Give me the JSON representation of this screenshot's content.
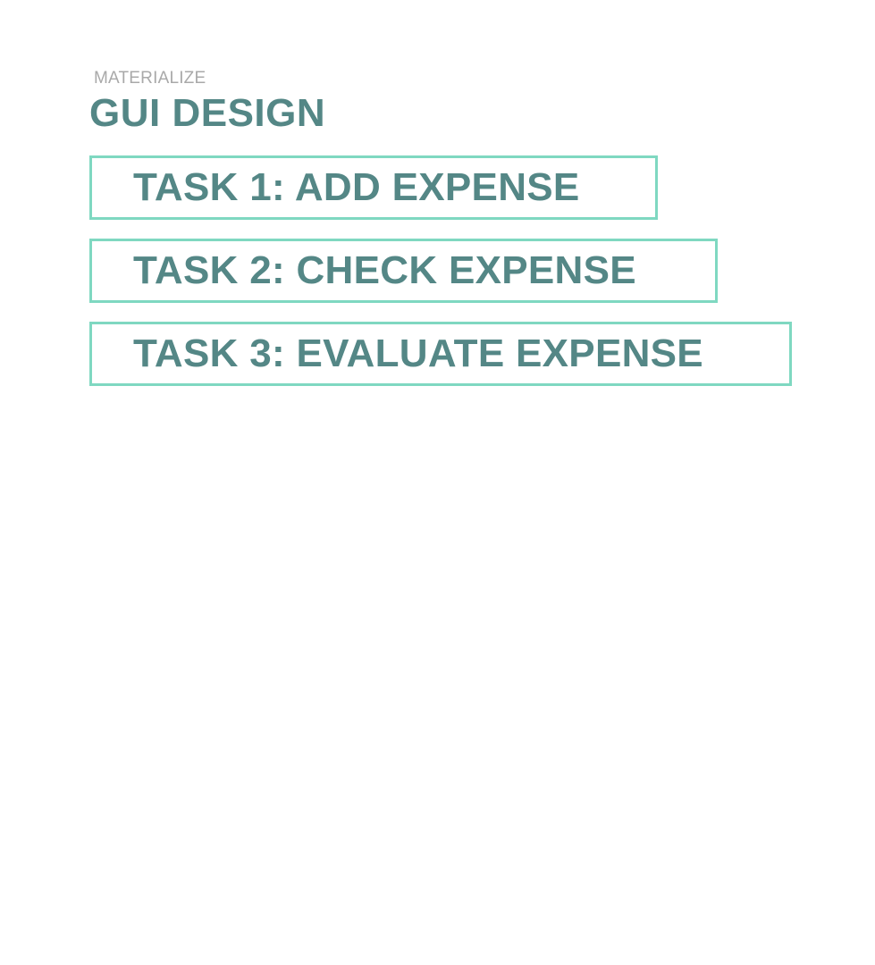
{
  "header": {
    "eyebrow": "MATERIALIZE",
    "title": "GUI DESIGN"
  },
  "tasks": [
    {
      "label": "TASK 1: ADD EXPENSE"
    },
    {
      "label": "TASK 2: CHECK EXPENSE"
    },
    {
      "label": "TASK 3: EVALUATE EXPENSE"
    }
  ],
  "colors": {
    "eyebrow": "#a9a9a9",
    "title": "#548786",
    "task_border": "#7fd8c1",
    "background": "#ffffff"
  }
}
